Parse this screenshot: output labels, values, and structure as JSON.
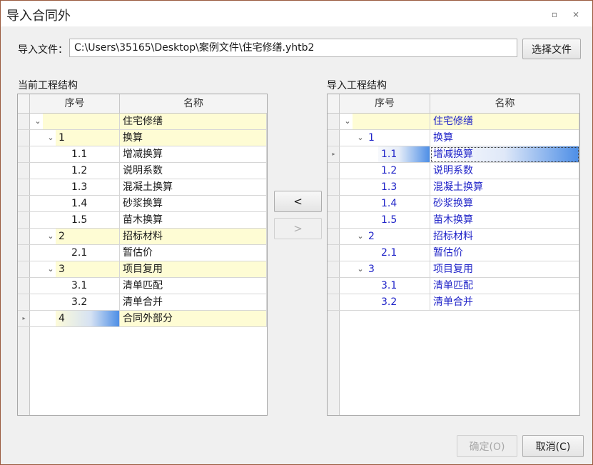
{
  "window": {
    "title": "导入合同外",
    "restore_glyph": "▫",
    "close_glyph": "⨯"
  },
  "file": {
    "label": "导入文件：",
    "path": "C:\\Users\\35165\\Desktop\\案例文件\\住宅修缮.yhtb2",
    "choose_label": "选择文件"
  },
  "left_panel": {
    "title": "当前工程结构",
    "columns": [
      "序号",
      "名称"
    ],
    "rows": [
      {
        "no": "",
        "name": "住宅修缮",
        "level": 0,
        "toggle": "⌄",
        "kind": "parent"
      },
      {
        "no": "1",
        "name": "换算",
        "level": 1,
        "toggle": "⌄",
        "kind": "parent"
      },
      {
        "no": "1.1",
        "name": "增减换算",
        "level": 2,
        "toggle": "",
        "kind": "child"
      },
      {
        "no": "1.2",
        "name": "说明系数",
        "level": 2,
        "toggle": "",
        "kind": "child"
      },
      {
        "no": "1.3",
        "name": "混凝土换算",
        "level": 2,
        "toggle": "",
        "kind": "child"
      },
      {
        "no": "1.4",
        "name": "砂浆换算",
        "level": 2,
        "toggle": "",
        "kind": "child"
      },
      {
        "no": "1.5",
        "name": "苗木换算",
        "level": 2,
        "toggle": "",
        "kind": "child"
      },
      {
        "no": "2",
        "name": "招标材料",
        "level": 1,
        "toggle": "⌄",
        "kind": "parent"
      },
      {
        "no": "2.1",
        "name": "暂估价",
        "level": 2,
        "toggle": "",
        "kind": "child"
      },
      {
        "no": "3",
        "name": "项目复用",
        "level": 1,
        "toggle": "⌄",
        "kind": "parent"
      },
      {
        "no": "3.1",
        "name": "清单匹配",
        "level": 2,
        "toggle": "",
        "kind": "child"
      },
      {
        "no": "3.2",
        "name": "清单合并",
        "level": 2,
        "toggle": "",
        "kind": "child"
      },
      {
        "no": "4",
        "name": "合同外部分",
        "level": 1,
        "toggle": "",
        "kind": "parent",
        "current": true,
        "selected_no": true
      }
    ]
  },
  "right_panel": {
    "title": "导入工程结构",
    "columns": [
      "序号",
      "名称"
    ],
    "rows": [
      {
        "no": "",
        "name": "住宅修缮",
        "level": 0,
        "toggle": "⌄",
        "kind": "parent"
      },
      {
        "no": "1",
        "name": "换算",
        "level": 1,
        "toggle": "⌄",
        "kind": "child"
      },
      {
        "no": "1.1",
        "name": "增减换算",
        "level": 2,
        "toggle": "",
        "kind": "child",
        "current": true,
        "selected_no": true,
        "focus_name": true
      },
      {
        "no": "1.2",
        "name": "说明系数",
        "level": 2,
        "toggle": "",
        "kind": "child"
      },
      {
        "no": "1.3",
        "name": "混凝土换算",
        "level": 2,
        "toggle": "",
        "kind": "child"
      },
      {
        "no": "1.4",
        "name": "砂浆换算",
        "level": 2,
        "toggle": "",
        "kind": "child"
      },
      {
        "no": "1.5",
        "name": "苗木换算",
        "level": 2,
        "toggle": "",
        "kind": "child"
      },
      {
        "no": "2",
        "name": "招标材料",
        "level": 1,
        "toggle": "⌄",
        "kind": "child"
      },
      {
        "no": "2.1",
        "name": "暂估价",
        "level": 2,
        "toggle": "",
        "kind": "child"
      },
      {
        "no": "3",
        "name": "项目复用",
        "level": 1,
        "toggle": "⌄",
        "kind": "child"
      },
      {
        "no": "3.1",
        "name": "清单匹配",
        "level": 2,
        "toggle": "",
        "kind": "child"
      },
      {
        "no": "3.2",
        "name": "清单合并",
        "level": 2,
        "toggle": "",
        "kind": "child"
      }
    ]
  },
  "transfer": {
    "left_label": "<",
    "right_label": ">"
  },
  "footer": {
    "ok_label": "确定(O)",
    "cancel_label": "取消(C)"
  },
  "colors": {
    "parent_row": "#fefcd4",
    "import_text": "#2024c8",
    "selection_accent": "#4d8ee6",
    "window_border": "#9a5a3e"
  },
  "current_row_glyph": "▸"
}
